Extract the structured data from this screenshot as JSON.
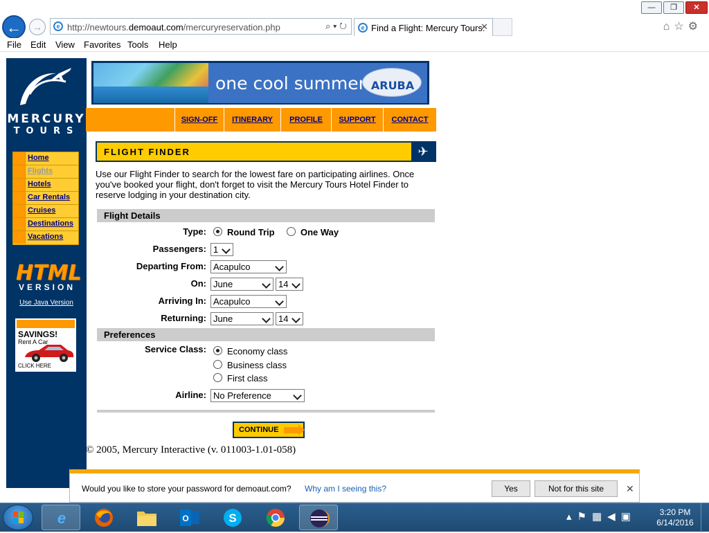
{
  "browser": {
    "address": {
      "prefix": "http://newtours.",
      "domain": "demoaut.com",
      "path": "/mercuryreservation.php"
    },
    "tab_title": "Find a Flight: Mercury Tours:",
    "menu": [
      "File",
      "Edit",
      "View",
      "Favorites",
      "Tools",
      "Help"
    ],
    "window_buttons": {
      "minimize": "—",
      "restore": "❐",
      "close": "✕"
    }
  },
  "sidebar": {
    "logo": {
      "line1": "MERCURY",
      "line2": "TOURS"
    },
    "items": [
      {
        "label": "Home",
        "active": false
      },
      {
        "label": "Flights",
        "active": true
      },
      {
        "label": "Hotels",
        "active": false
      },
      {
        "label": "Car Rentals",
        "active": false
      },
      {
        "label": "Cruises",
        "active": false
      },
      {
        "label": "Destinations",
        "active": false
      },
      {
        "label": "Vacations",
        "active": false
      }
    ],
    "html_logo": {
      "html": "HTML",
      "version": "VERSION"
    },
    "java_link": "Use Java Version",
    "ad": {
      "title": "SAVINGS!",
      "subtitle": "Rent A Car",
      "cta": "CLICK HERE"
    }
  },
  "banner": {
    "text": "one cool summer",
    "brand": "ARUBA"
  },
  "topnav": [
    "SIGN-OFF",
    "ITINERARY",
    "PROFILE",
    "SUPPORT",
    "CONTACT"
  ],
  "finder": {
    "title": "FLIGHT FINDER",
    "intro": "Use our Flight Finder to search for the lowest fare on participating airlines. Once you've booked your flight, don't forget to visit the Mercury Tours Hotel Finder to reserve lodging in your destination city.",
    "flight_details_heading": "Flight Details",
    "type_label": "Type:",
    "type_options": [
      "Round Trip",
      "One Way"
    ],
    "type_selected": "Round Trip",
    "passengers_label": "Passengers:",
    "passengers": "1",
    "departing_label": "Departing From:",
    "departing": "Acapulco",
    "on_label": "On:",
    "on_month": "June",
    "on_day": "14",
    "arriving_label": "Arriving In:",
    "arriving": "Acapulco",
    "returning_label": "Returning:",
    "return_month": "June",
    "return_day": "14",
    "preferences_heading": "Preferences",
    "service_label": "Service Class:",
    "service_options": [
      "Economy class",
      "Business class",
      "First class"
    ],
    "service_selected": "Economy class",
    "airline_label": "Airline:",
    "airline": "No Preference",
    "continue_label": "CONTINUE"
  },
  "copyright": "© 2005, Mercury Interactive (v. 011003-1.01-058)",
  "password_prompt": {
    "question": "Would you like to store your password for demoaut.com?",
    "why_link": "Why am I seeing this?",
    "yes": "Yes",
    "not_for_site": "Not for this site"
  },
  "taskbar": {
    "time": "3:20 PM",
    "date": "6/14/2016",
    "apps": [
      "internet-explorer",
      "firefox",
      "file-explorer",
      "outlook",
      "skype",
      "chrome",
      "eclipse"
    ]
  },
  "colors": {
    "navy": "#003366",
    "orange": "#ff9900",
    "yellow": "#ffcc00",
    "link": "#000080"
  }
}
